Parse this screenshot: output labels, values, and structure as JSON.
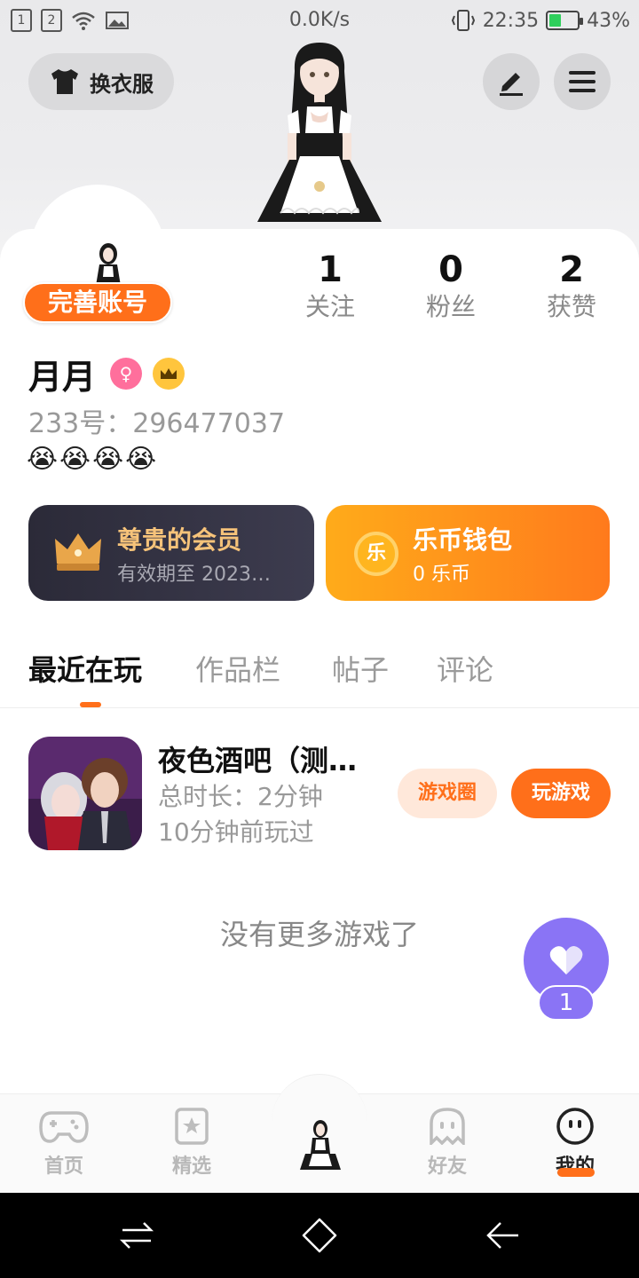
{
  "status_bar": {
    "sim1": "1",
    "sim2": "2",
    "network_speed": "0.0K/s",
    "time": "22:35",
    "battery": "43%",
    "battery_level": 0.43
  },
  "header": {
    "dress_button_label": "换衣服",
    "dress_icon": "tshirt-icon",
    "edit_icon": "pencil-icon",
    "menu_icon": "menu-icon"
  },
  "profile": {
    "complete_account_label": "完善账号",
    "stats": [
      {
        "value": "1",
        "label": "关注"
      },
      {
        "value": "0",
        "label": "粉丝"
      },
      {
        "value": "2",
        "label": "获赞"
      }
    ],
    "username": "月月",
    "gender_icon": "female-icon",
    "vip_icon": "crown-icon",
    "account_id": "233号：296477037",
    "bio": "😭😭😭😭"
  },
  "vip_card": {
    "title": "尊贵的会员",
    "subtitle": "有效期至 2023…"
  },
  "wallet_card": {
    "coin_char": "乐",
    "title": "乐币钱包",
    "subtitle": "0 乐币"
  },
  "tabs": [
    {
      "label": "最近在玩",
      "active": true
    },
    {
      "label": "作品栏",
      "active": false
    },
    {
      "label": "帖子",
      "active": false
    },
    {
      "label": "评论",
      "active": false
    }
  ],
  "recent_game": {
    "title": "夜色酒吧（测…",
    "duration": "总时长：2分钟",
    "last_played": "10分钟前玩过",
    "circle_button": "游戏圈",
    "play_button": "玩游戏"
  },
  "no_more_text": "没有更多游戏了",
  "heart_fab": {
    "count": "1"
  },
  "bottom_nav": [
    {
      "label": "首页",
      "icon": "gamepad-icon",
      "active": false
    },
    {
      "label": "精选",
      "icon": "star-bookmark-icon",
      "active": false
    },
    {
      "label": "",
      "icon": "avatar-icon",
      "active": false
    },
    {
      "label": "好友",
      "icon": "ghost-icon",
      "active": false
    },
    {
      "label": "我的",
      "icon": "face-icon",
      "active": true
    }
  ],
  "colors": {
    "accent": "#ff6f1a",
    "vip_dark": "#2b2a38",
    "vip_gold": "#f6c37a",
    "wallet_orange": "#ff9a1c",
    "heart_purple": "#8a74f5"
  }
}
